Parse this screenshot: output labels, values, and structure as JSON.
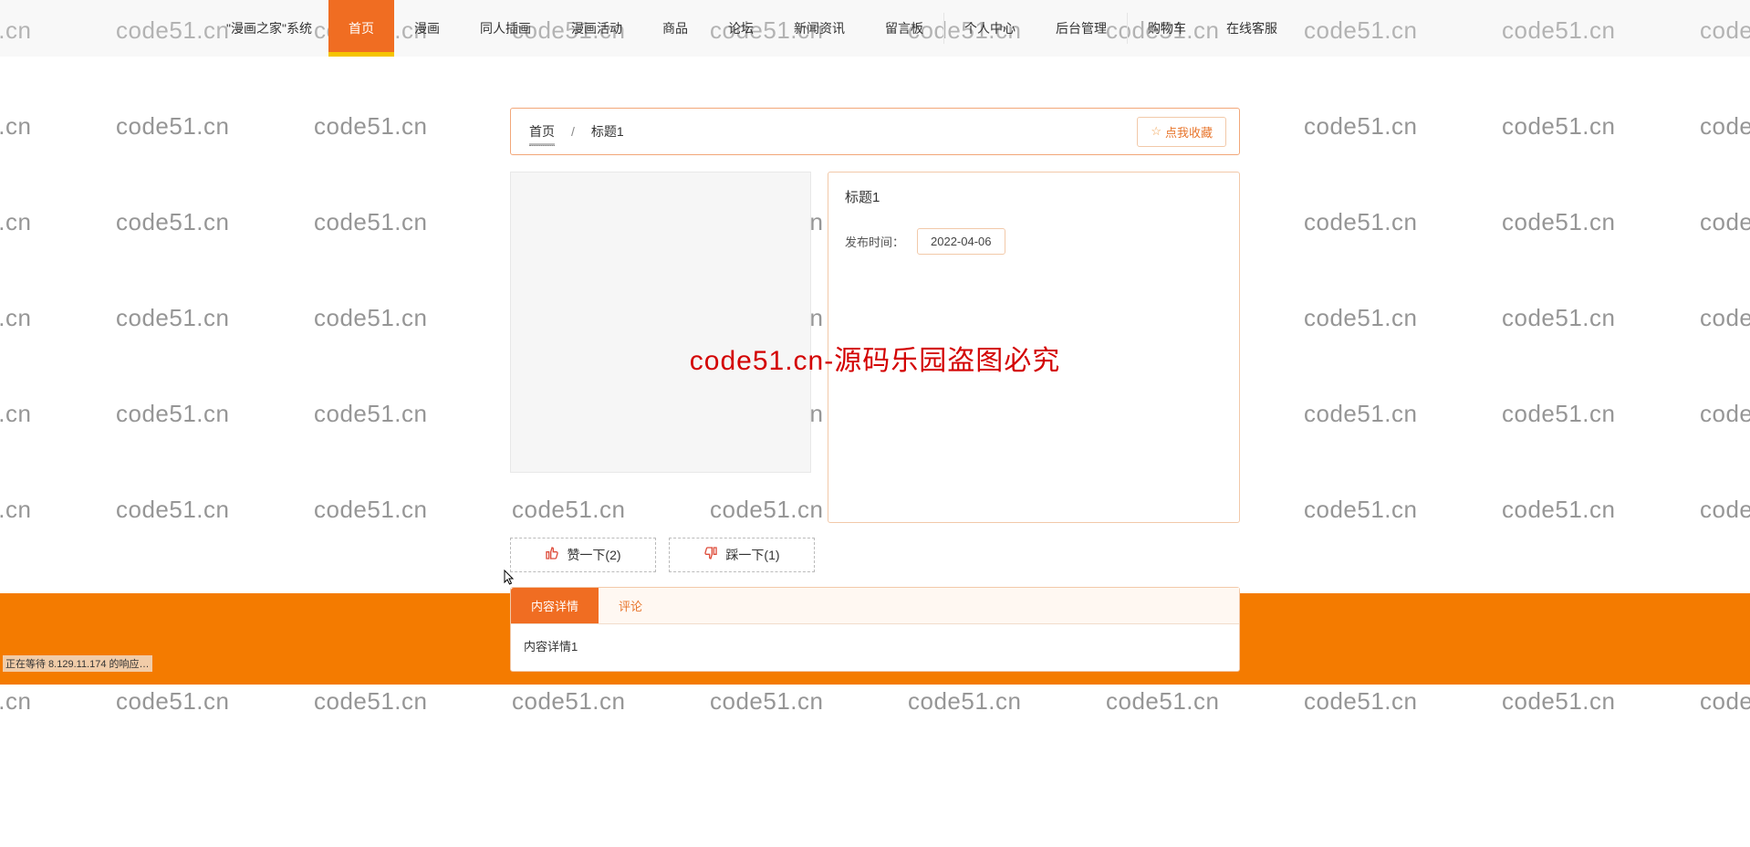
{
  "brand_text": "\"漫画之家\"系统",
  "watermark_text": "code51.cn",
  "big_red_text": "code51.cn-源码乐园盗图必究",
  "nav": {
    "items": [
      {
        "label": "首页",
        "active": true
      },
      {
        "label": "漫画",
        "active": false
      },
      {
        "label": "同人插画",
        "active": false
      },
      {
        "label": "漫画活动",
        "active": false
      },
      {
        "label": "商品",
        "active": false
      },
      {
        "label": "论坛",
        "active": false
      },
      {
        "label": "新闻资讯",
        "active": false
      },
      {
        "label": "留言板",
        "active": false
      },
      {
        "label": "个人中心",
        "active": false,
        "sep_before": true
      },
      {
        "label": "后台管理",
        "active": false
      },
      {
        "label": "购物车",
        "active": false,
        "sep_before": true
      },
      {
        "label": "在线客服",
        "active": false
      }
    ]
  },
  "breadcrumb": {
    "home": "首页",
    "slash": "/",
    "current": "标题1"
  },
  "fav_button": "点我收藏",
  "detail": {
    "title": "标题1",
    "publish_label": "发布时间：",
    "publish_date": "2022-04-06"
  },
  "reactions": {
    "like_label": "赞一下(2)",
    "dislike_label": "踩一下(1)"
  },
  "tabs": {
    "content": "内容详情",
    "comments": "评论"
  },
  "content_body": "内容详情1",
  "status_text": "正在等待 8.129.11.174 的响应…"
}
